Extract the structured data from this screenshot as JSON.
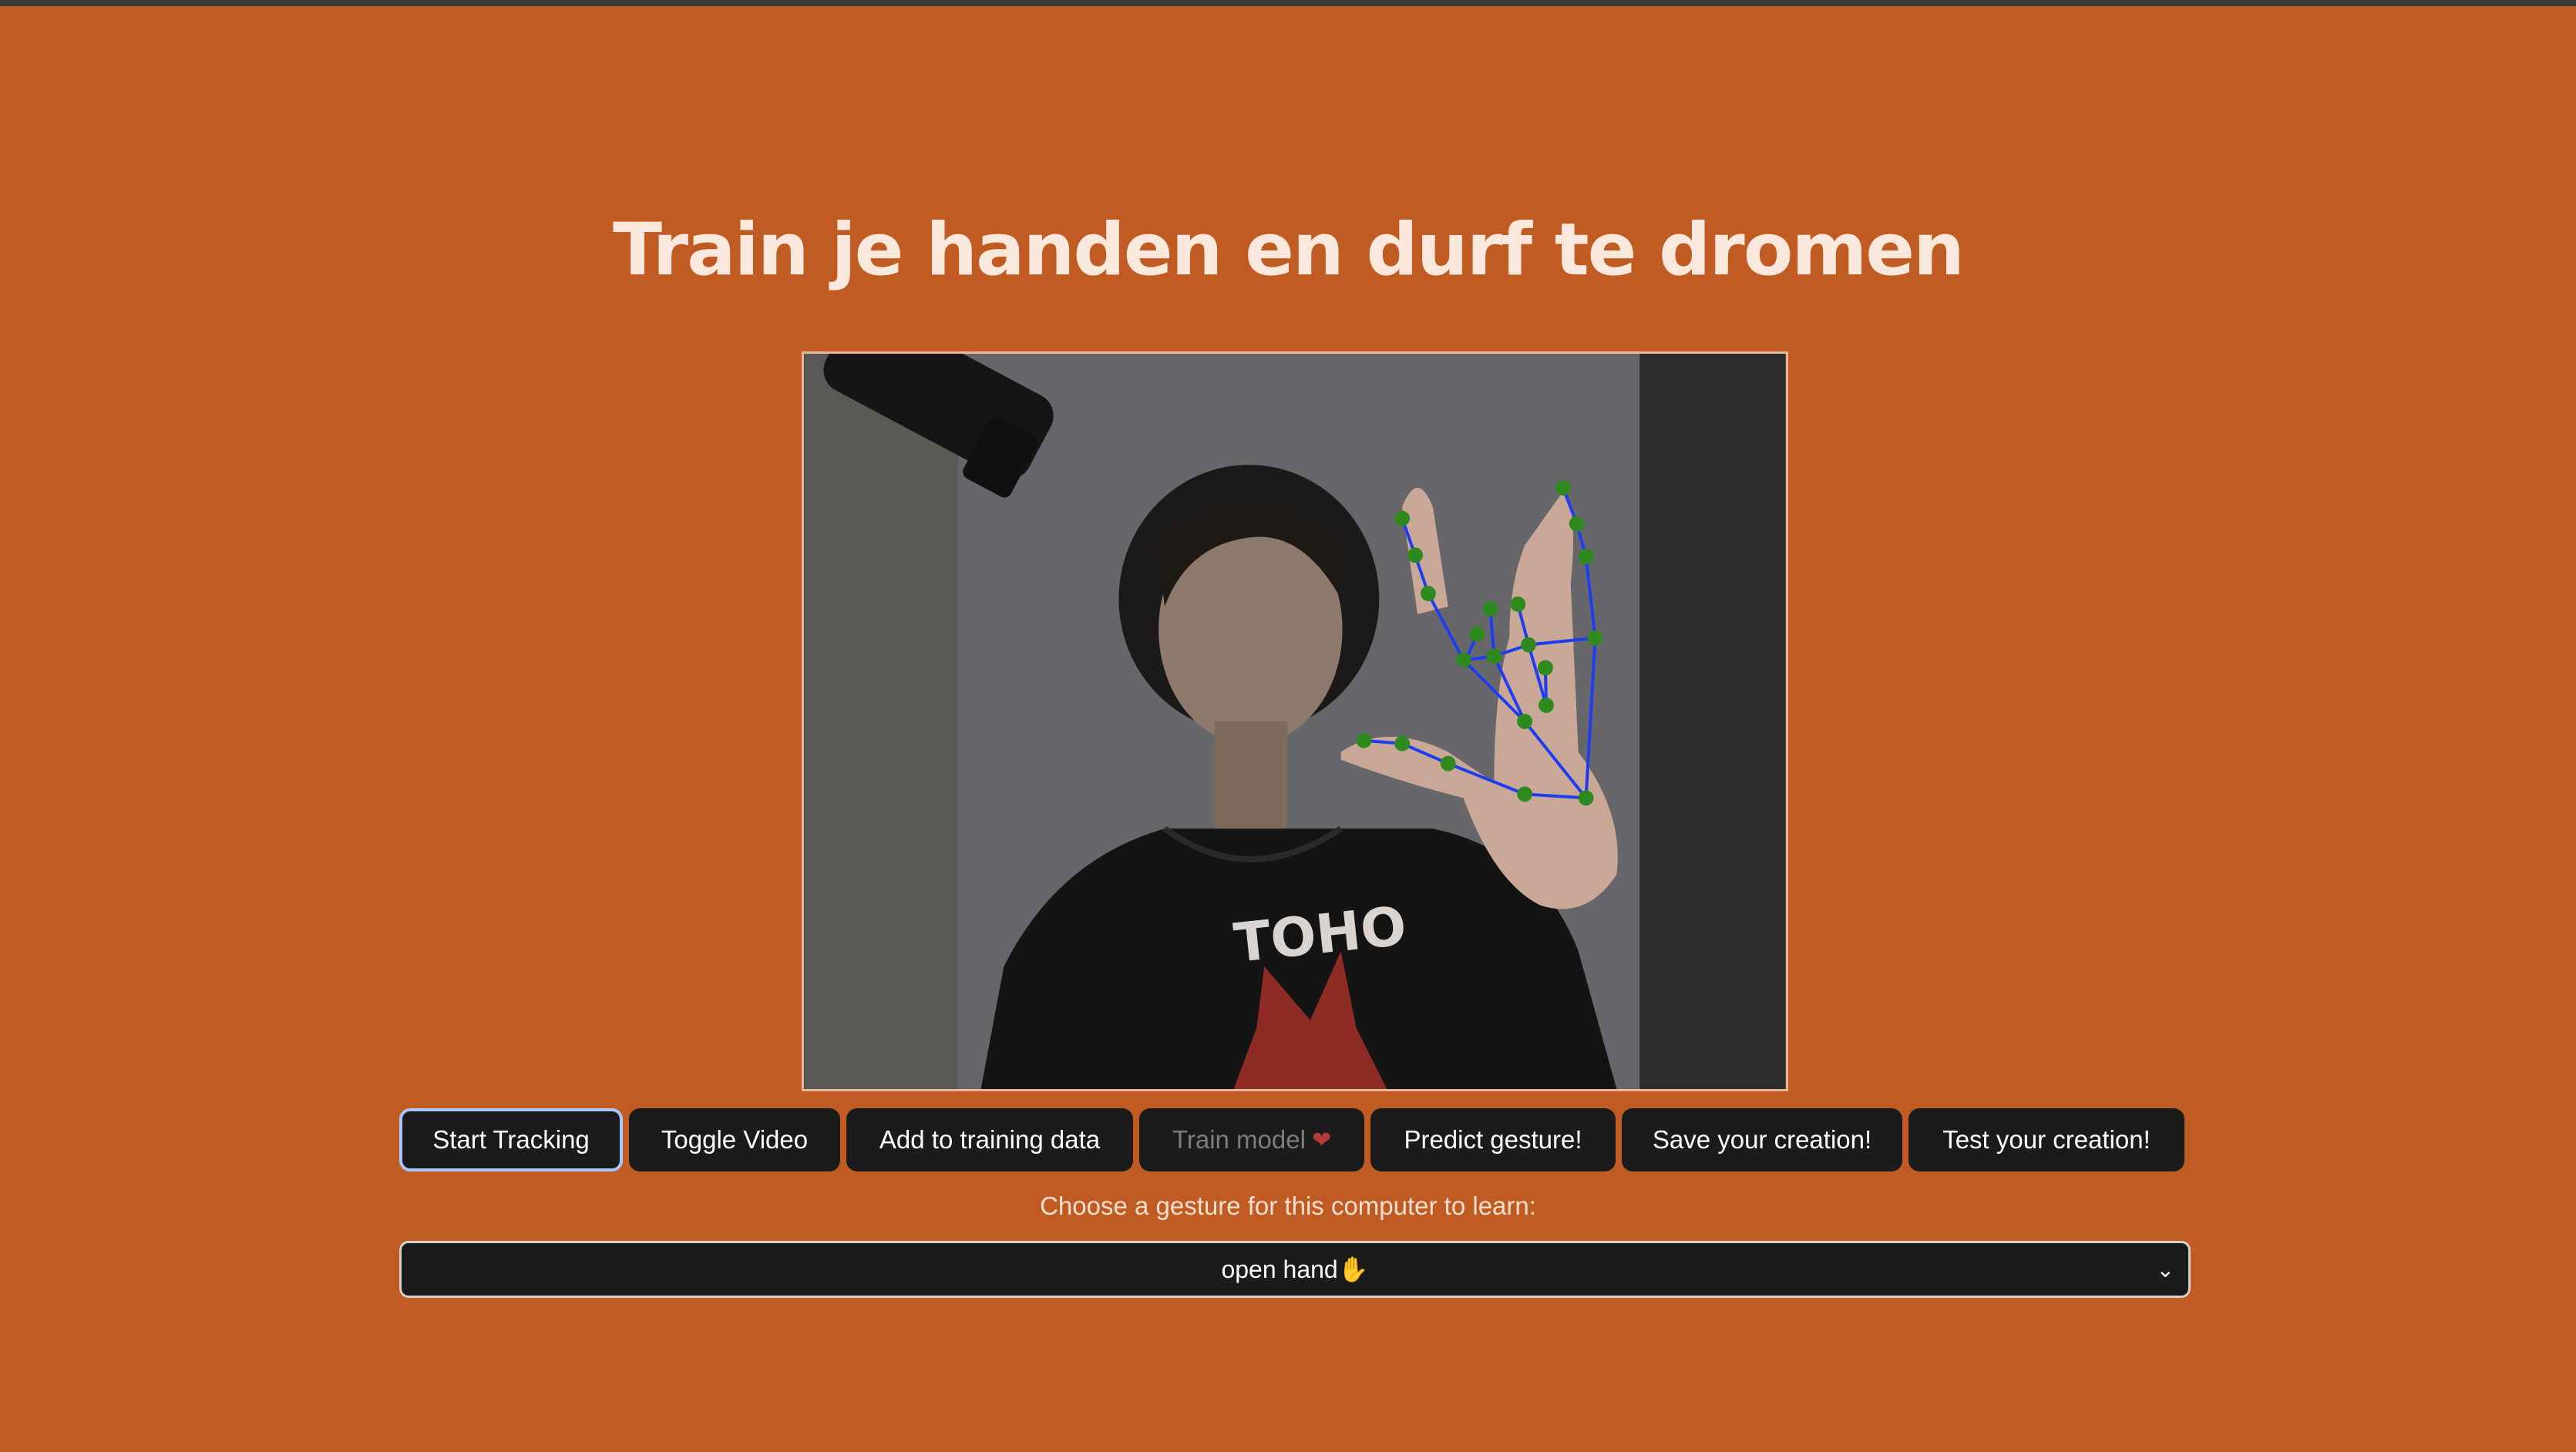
{
  "page": {
    "title": "Train je handen en durf te dromen"
  },
  "buttons": {
    "start_tracking": "Start Tracking",
    "toggle_video": "Toggle Video",
    "add_training": "Add to training data",
    "train_model": "Train model",
    "predict": "Predict gesture!",
    "save": "Save your creation!",
    "test": "Test your creation!"
  },
  "gesture_picker": {
    "label": "Choose a gesture for this computer to learn:",
    "selected": "open hand",
    "selected_emoji": "✋"
  },
  "video": {
    "shirt_text": "TOHO",
    "landmark_color": "#2e8a1f",
    "connector_color": "#1f3df0"
  }
}
